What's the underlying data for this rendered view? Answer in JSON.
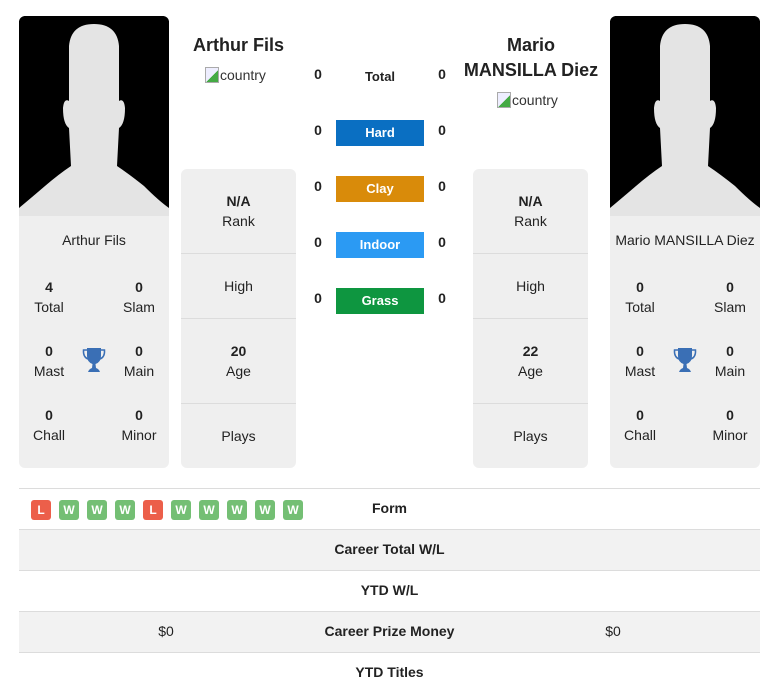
{
  "player1": {
    "name": "Arthur Fils",
    "card_name": "Arthur Fils",
    "country_alt": "country",
    "titles": {
      "total": {
        "value": "4",
        "label": "Total"
      },
      "slam": {
        "value": "0",
        "label": "Slam"
      },
      "mast": {
        "value": "0",
        "label": "Mast"
      },
      "main": {
        "value": "0",
        "label": "Main"
      },
      "chall": {
        "value": "0",
        "label": "Chall"
      },
      "minor": {
        "value": "0",
        "label": "Minor"
      }
    },
    "info": {
      "rank": {
        "value": "N/A",
        "label": "Rank"
      },
      "high": {
        "value": "",
        "label": "High"
      },
      "age": {
        "value": "20",
        "label": "Age"
      },
      "plays": {
        "value": "",
        "label": "Plays"
      }
    }
  },
  "player2": {
    "name": "Mario MANSILLA Diez",
    "name_line1": "Mario",
    "name_line2": "MANSILLA Diez",
    "card_name": "Mario MANSILLA Diez",
    "country_alt": "country",
    "titles": {
      "total": {
        "value": "0",
        "label": "Total"
      },
      "slam": {
        "value": "0",
        "label": "Slam"
      },
      "mast": {
        "value": "0",
        "label": "Mast"
      },
      "main": {
        "value": "0",
        "label": "Main"
      },
      "chall": {
        "value": "0",
        "label": "Chall"
      },
      "minor": {
        "value": "0",
        "label": "Minor"
      }
    },
    "info": {
      "rank": {
        "value": "N/A",
        "label": "Rank"
      },
      "high": {
        "value": "",
        "label": "High"
      },
      "age": {
        "value": "22",
        "label": "Age"
      },
      "plays": {
        "value": "",
        "label": "Plays"
      }
    }
  },
  "h2h": {
    "total": {
      "label": "Total",
      "p1": "0",
      "p2": "0"
    },
    "surfaces": [
      {
        "label": "Hard",
        "p1": "0",
        "p2": "0",
        "color": "#0a6fc2"
      },
      {
        "label": "Clay",
        "p1": "0",
        "p2": "0",
        "color": "#d98b0a"
      },
      {
        "label": "Indoor",
        "p1": "0",
        "p2": "0",
        "color": "#2b9af3"
      },
      {
        "label": "Grass",
        "p1": "0",
        "p2": "0",
        "color": "#0e9640"
      }
    ]
  },
  "table": {
    "form": {
      "label": "Form",
      "p1": [
        "L",
        "W",
        "W",
        "W",
        "L",
        "W",
        "W",
        "W",
        "W",
        "W"
      ]
    },
    "career_wl": {
      "label": "Career Total W/L",
      "p1": "",
      "p2": ""
    },
    "ytd_wl": {
      "label": "YTD W/L",
      "p1": "",
      "p2": ""
    },
    "prize": {
      "label": "Career Prize Money",
      "p1": "$0",
      "p2": "$0"
    },
    "ytd_titles": {
      "label": "YTD Titles",
      "p1": "",
      "p2": ""
    }
  },
  "colors": {
    "loss": "#ec5f4a",
    "win": "#74bf74",
    "trophy": "#3a6fb5"
  }
}
